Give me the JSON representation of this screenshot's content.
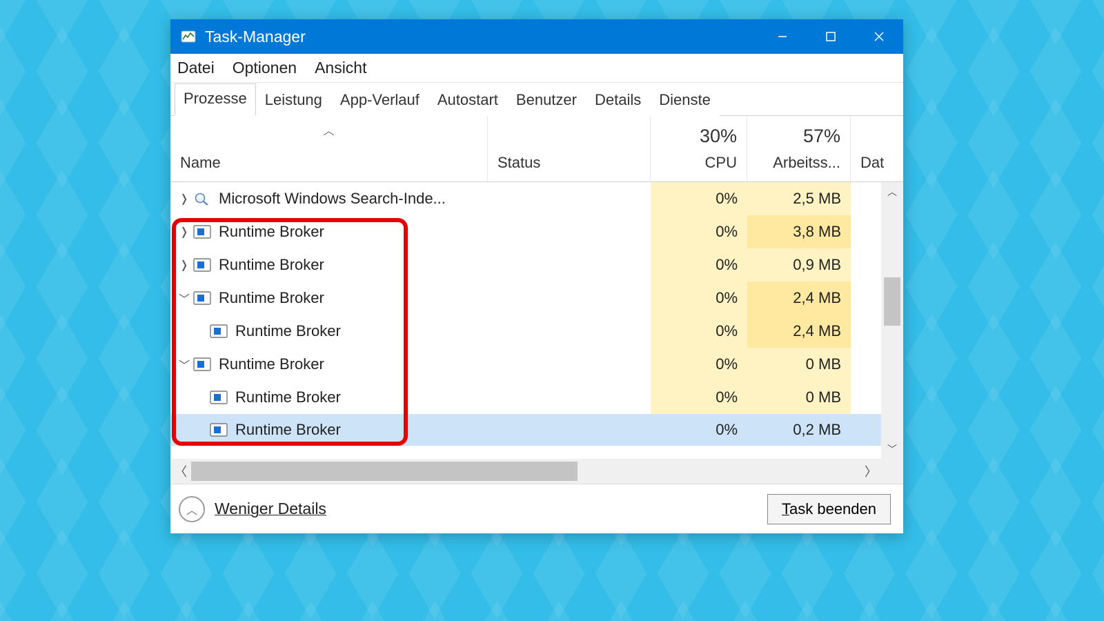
{
  "window": {
    "title": "Task-Manager"
  },
  "menu": {
    "items": [
      "Datei",
      "Optionen",
      "Ansicht"
    ]
  },
  "tabs": {
    "items": [
      "Prozesse",
      "Leistung",
      "App-Verlauf",
      "Autostart",
      "Benutzer",
      "Details",
      "Dienste"
    ],
    "active_index": 0
  },
  "columns": {
    "name": "Name",
    "status": "Status",
    "cpu_label": "CPU",
    "cpu_pct": "30%",
    "mem_label": "Arbeitss...",
    "mem_pct": "57%",
    "dat_label": "Dat"
  },
  "rows": [
    {
      "expander": "right",
      "indent": 0,
      "icon": "search",
      "name": "Microsoft Windows Search-Inde...",
      "cpu": "0%",
      "mem": "2,5 MB",
      "mem_darker": false,
      "selected": false
    },
    {
      "expander": "right",
      "indent": 0,
      "icon": "app",
      "name": "Runtime Broker",
      "cpu": "0%",
      "mem": "3,8 MB",
      "mem_darker": true,
      "selected": false
    },
    {
      "expander": "right",
      "indent": 0,
      "icon": "app",
      "name": "Runtime Broker",
      "cpu": "0%",
      "mem": "0,9 MB",
      "mem_darker": false,
      "selected": false
    },
    {
      "expander": "down",
      "indent": 0,
      "icon": "app",
      "name": "Runtime Broker",
      "cpu": "0%",
      "mem": "2,4 MB",
      "mem_darker": true,
      "selected": false
    },
    {
      "expander": "none",
      "indent": 1,
      "icon": "app",
      "name": "Runtime Broker",
      "cpu": "0%",
      "mem": "2,4 MB",
      "mem_darker": true,
      "selected": false
    },
    {
      "expander": "down",
      "indent": 0,
      "icon": "app",
      "name": "Runtime Broker",
      "cpu": "0%",
      "mem": "0 MB",
      "mem_darker": false,
      "selected": false
    },
    {
      "expander": "none",
      "indent": 1,
      "icon": "app",
      "name": "Runtime Broker",
      "cpu": "0%",
      "mem": "0 MB",
      "mem_darker": false,
      "selected": false
    },
    {
      "expander": "none",
      "indent": 1,
      "icon": "app",
      "name": "Runtime Broker",
      "cpu": "0%",
      "mem": "0,2 MB",
      "mem_darker": false,
      "selected": true
    }
  ],
  "footer": {
    "fewer_details": "Weniger Details",
    "end_task": "Task beenden"
  },
  "highlight": {
    "note": "Red rectangle highlights Runtime Broker entries (rows 2–8)"
  }
}
